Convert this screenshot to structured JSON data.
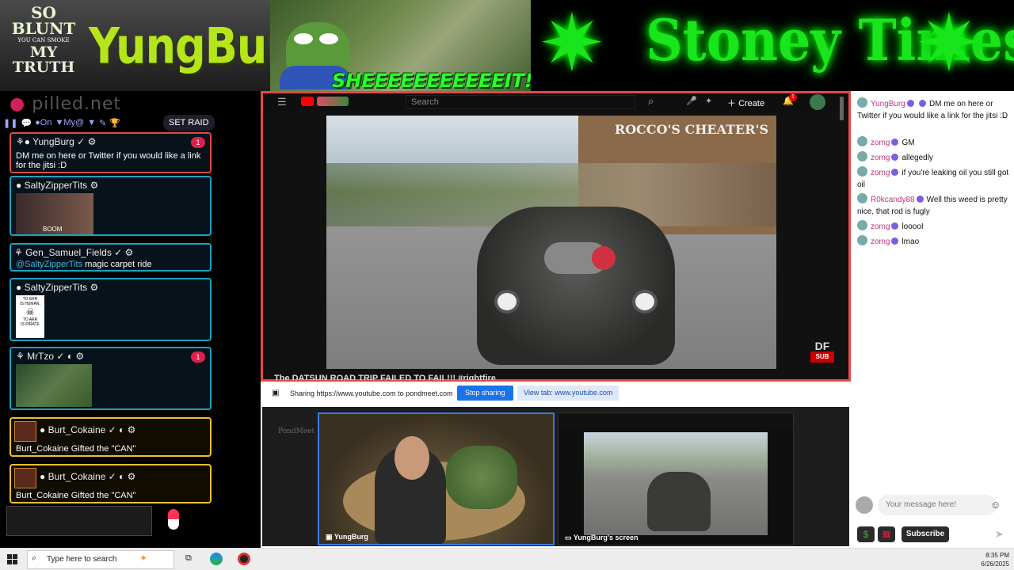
{
  "banners": {
    "so_blunt_line1": "SO",
    "so_blunt_line1b": "BLUNT",
    "so_blunt_line2": "YOU CAN SMOKE",
    "so_blunt_line3": "MY TRUTH",
    "yungburg_logo": "YungBurg",
    "sheeit": "SHEEEEEEEEEEEIT!",
    "stoney_times": "Stoney Times"
  },
  "left_chat": {
    "logo": "pilled.net",
    "toolbar": {
      "on_label": "On",
      "my_label": "My@"
    },
    "set_raid": "SET RAID",
    "messages": [
      {
        "user": "YungBurg",
        "text": "DM me on here or Twitter if you would like a link for the jitsi :D",
        "badge": "1"
      },
      {
        "user": "SaltyZipperTits",
        "caption": "BOOM"
      },
      {
        "user": "Gen_Samuel_Fields",
        "mention": "@SaltyZipperTits",
        "text": "magic carpet ride"
      },
      {
        "user": "SaltyZipperTits",
        "caption_lines": [
          "TO ERR",
          "IS HUMAN,",
          "TO ARR",
          "IS PIRATE"
        ]
      },
      {
        "user": "MrTzo",
        "badge": "1"
      },
      {
        "user": "Burt_Cokaine",
        "text": "Burt_Cokaine Gifted the \"CAN\""
      },
      {
        "user": "Burt_Cokaine",
        "text": "Burt_Cokaine Gifted the \"CAN\""
      }
    ]
  },
  "youtube": {
    "search_placeholder": "Search",
    "create_label": "Create",
    "notif_count": "1",
    "building_sign": "ROCCO'S CHEATER'S",
    "df_label": "DF",
    "sub_label": "SUB",
    "title_strip": "The DATSUN ROAD TRIP FAILED TO FAIL!!! #rightfire"
  },
  "share_bar": {
    "text": "Sharing https://www.youtube.com to pondmeet.com",
    "stop_label": "Stop sharing",
    "view_tab_label": "View tab: www.youtube.com"
  },
  "meet": {
    "watermark": "PondMeet",
    "cam_label": "YungBurg",
    "screen_label": "YungBurg's screen"
  },
  "right_chat": {
    "messages": [
      {
        "user": "YungBurg",
        "text": "DM me on here or Twitter if you would like a link for the jitsi :D"
      },
      {
        "user": "zomg",
        "text": "GM"
      },
      {
        "user": "zomg",
        "text": "allegedly"
      },
      {
        "user": "zomg",
        "text": "if you're leaking oil you still got oil"
      },
      {
        "user": "R0kcandy88",
        "text": "Well this weed is pretty nice, that rod is fugly"
      },
      {
        "user": "zomg",
        "text": "looooI"
      },
      {
        "user": "zomg",
        "text": "lmao"
      }
    ],
    "input_placeholder": "Your message here!",
    "subscribe_label": "Subscribe"
  },
  "taskbar": {
    "search_placeholder": "Type here to search",
    "time": "8:35 PM",
    "date": "6/26/2025"
  },
  "colors": {
    "accent_blue": "#1a73e8",
    "alert_red": "#e84848",
    "neon_green": "#19e51c",
    "username_pink": "#c0357a"
  }
}
